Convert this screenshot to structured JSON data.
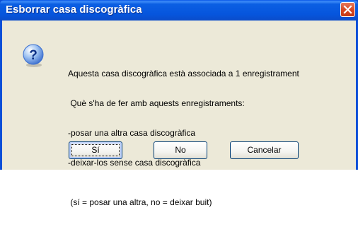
{
  "dialog": {
    "title": "Esborrar casa discogràfica",
    "message_lines": [
      "Aquesta casa discogràfica està associada a 1 enregistrament",
      " Què s'ha de fer amb aquests enregistraments:",
      "-posar una altra casa discogràfica",
      "-deixar-los sense casa discogràfica"
    ],
    "hint": " (sí = posar una altra, no = deixar buit)",
    "icon": "question-icon"
  },
  "buttons": {
    "yes_label": "Sí",
    "no_label": "No",
    "cancel_label": "Cancelar"
  },
  "colors": {
    "titlebar": "#0655dd",
    "client_bg": "#ece9d8",
    "close_button": "#d6451f"
  }
}
